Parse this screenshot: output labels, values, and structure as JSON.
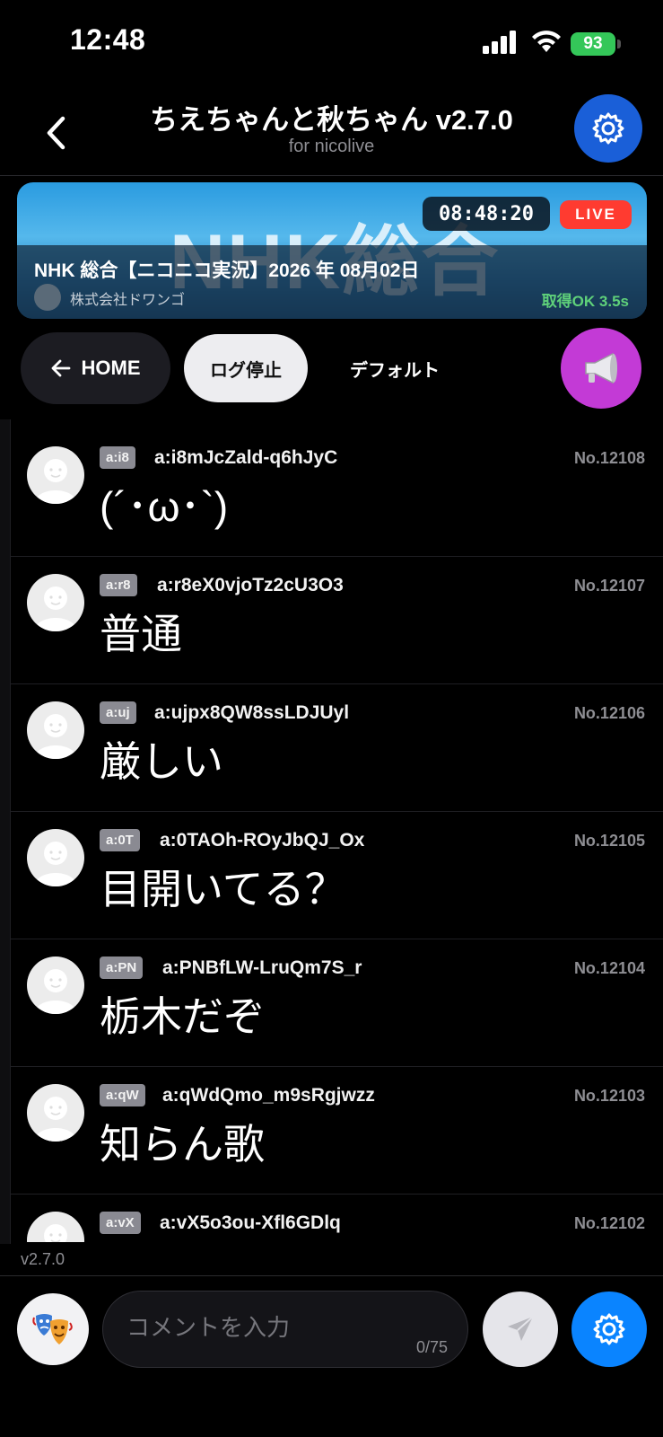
{
  "status": {
    "time": "12:48",
    "battery": "93"
  },
  "header": {
    "title": "ちえちゃんと秋ちゃん v2.7.0",
    "subtitle": "for nicolive"
  },
  "banner": {
    "thumbnail_text": "NHK総合",
    "timer": "08:48:20",
    "live": "LIVE",
    "title": "NHK 総合【ニコニコ実況】2026 年 08月02日",
    "channel": "株式会社ドワンゴ",
    "fetch_status": "取得OK 3.5s"
  },
  "controls": {
    "home": "HOME",
    "log_stop": "ログ停止",
    "default": "デフォルト"
  },
  "comments": [
    {
      "tag": "a:i8",
      "uid": "a:i8mJcZald-q6hJyC",
      "no": "No.12108",
      "text": "(´･ω･`)"
    },
    {
      "tag": "a:r8",
      "uid": "a:r8eX0vjoTz2cU3O3",
      "no": "No.12107",
      "text": "普通"
    },
    {
      "tag": "a:uj",
      "uid": "a:ujpx8QW8ssLDJUyl",
      "no": "No.12106",
      "text": "厳しい"
    },
    {
      "tag": "a:0T",
      "uid": "a:0TAOh-ROyJbQJ_Ox",
      "no": "No.12105",
      "text": "目開いてる？"
    },
    {
      "tag": "a:PN",
      "uid": "a:PNBfLW-LruQm7S_r",
      "no": "No.12104",
      "text": "栃木だぞ"
    },
    {
      "tag": "a:qW",
      "uid": "a:qWdQmo_m9sRgjwzz",
      "no": "No.12103",
      "text": "知らん歌"
    },
    {
      "tag": "a:vX",
      "uid": "a:vX5o3ou-Xfl6GDlq",
      "no": "No.12102",
      "text": ""
    }
  ],
  "version": "v2.7.0",
  "input": {
    "placeholder": "コメントを入力",
    "counter": "0/75"
  },
  "colors": {
    "accent": "#0a84ff",
    "live": "#ff3b30",
    "announce": "#c33ad6",
    "ok": "#5fd17a"
  },
  "icons": [
    "back-chevron-icon",
    "gear-icon",
    "arrow-left-icon",
    "megaphone-icon",
    "mask-icon",
    "send-icon",
    "default-avatar-icon"
  ]
}
